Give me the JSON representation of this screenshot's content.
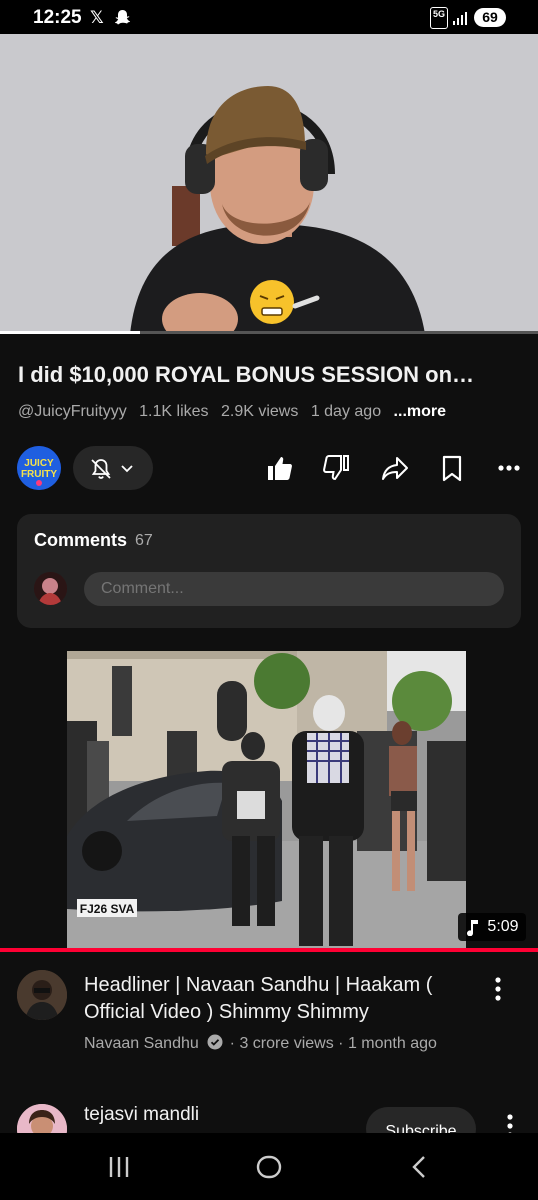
{
  "status_bar": {
    "time": "12:25",
    "network": "5G",
    "battery": "69"
  },
  "player": {
    "progress_fraction": 0.26
  },
  "video": {
    "title": "I did $10,000 ROYAL BONUS SESSION on…",
    "channel_handle": "@JuicyFruityyy",
    "likes": "1.1K likes",
    "views": "2.9K views",
    "age": "1 day ago",
    "more_label": "...more",
    "channel_avatar_text": "JUICY FRUITY"
  },
  "comments": {
    "title": "Comments",
    "count": "67",
    "placeholder": "Comment..."
  },
  "recommended": {
    "duration": "5:09",
    "plate": "FJ26 SVA",
    "title": "Headliner | Navaan Sandhu | Haakam ( Official Video ) Shimmy Shimmy",
    "channel": "Navaan Sandhu",
    "views": "3 crore views",
    "age": "1 month ago"
  },
  "next_item": {
    "channel": "tejasvi mandli",
    "subscribe_label": "Subscribe"
  },
  "icons": [
    "x-icon",
    "snapchat-icon",
    "signal-icon",
    "bell-off-icon",
    "chevron-down-icon",
    "thumbs-up-icon",
    "thumbs-down-icon",
    "share-icon",
    "save-icon",
    "more-icon",
    "music-note-icon",
    "verified-icon",
    "recents-icon",
    "home-icon",
    "back-icon"
  ]
}
